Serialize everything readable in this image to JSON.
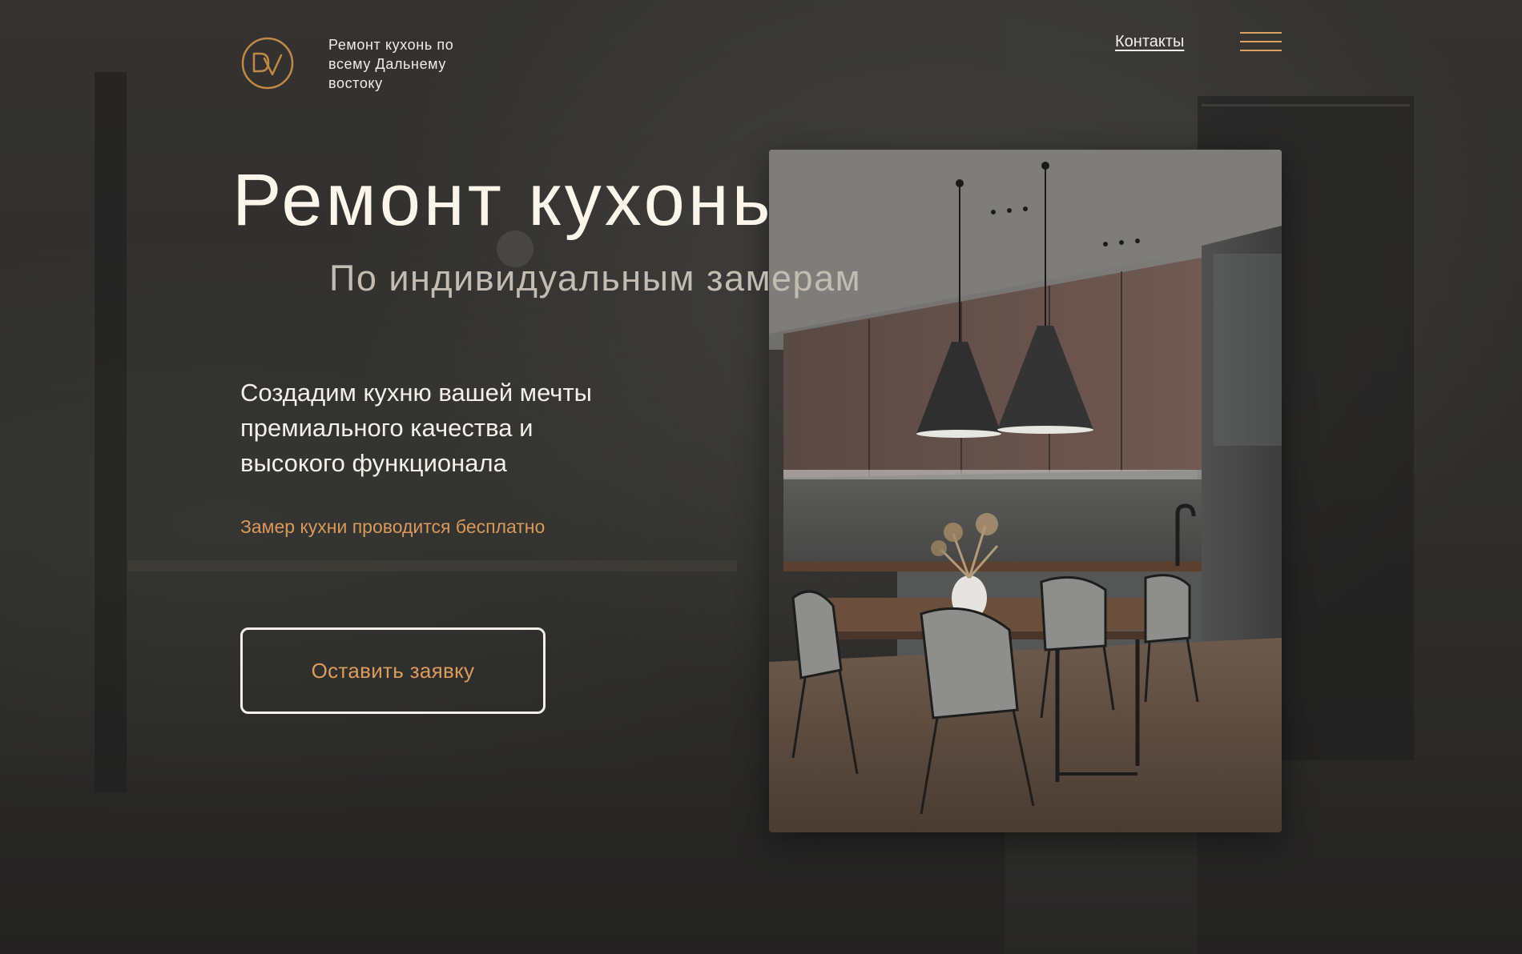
{
  "header": {
    "tagline_line1": "Ремонт кухонь по",
    "tagline_line2": "всему Дальнему",
    "tagline_line3": "востоку",
    "contacts_label": "Контакты",
    "logo_letters": "DV"
  },
  "hero": {
    "title": "Ремонт кухонь",
    "subtitle": "По индивидуальным замерам",
    "description_line1": "Создадим кухню вашей мечты",
    "description_line2": "премиального качества и",
    "description_line3": "высокого функционала",
    "free_measure": "Замер кухни проводится бесплатно",
    "cta_label": "Оставить заявку"
  },
  "colors": {
    "accent": "#d9a35f",
    "cta_text": "#dd9c5c",
    "background": "#2c2b2a",
    "text_light": "#f4f0e9"
  },
  "icons": {
    "logo": "dv-logo-icon",
    "menu": "hamburger-menu-icon"
  }
}
